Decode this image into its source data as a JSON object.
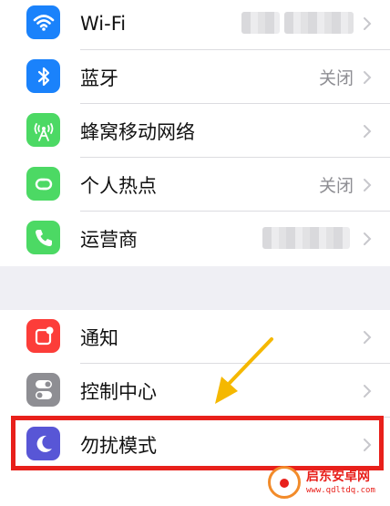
{
  "groups": [
    {
      "rows": [
        {
          "label": "Wi-Fi",
          "value": "",
          "icon": "wifi-icon",
          "color": "#1a82fb"
        },
        {
          "label": "蓝牙",
          "value": "关闭",
          "icon": "bluetooth-icon",
          "color": "#1a82fb"
        },
        {
          "label": "蜂窝移动网络",
          "value": "",
          "icon": "cellular-icon",
          "color": "#4cd964"
        },
        {
          "label": "个人热点",
          "value": "关闭",
          "icon": "hotspot-icon",
          "color": "#4cd964"
        },
        {
          "label": "运营商",
          "value": "",
          "icon": "phone-icon",
          "color": "#4cd964"
        }
      ]
    },
    {
      "rows": [
        {
          "label": "通知",
          "value": "",
          "icon": "notifications-icon",
          "color": "#fc3d39"
        },
        {
          "label": "控制中心",
          "value": "",
          "icon": "control-center-icon",
          "color": "#8e8e93"
        },
        {
          "label": "勿扰模式",
          "value": "",
          "icon": "moon-icon",
          "color": "#5856d6"
        }
      ]
    }
  ],
  "annotation": {
    "highlight_color": "#e8201b",
    "arrow_color": "#f5b800"
  },
  "watermark": {
    "title": "启东安卓网",
    "url": "www.qdltdq.com"
  }
}
